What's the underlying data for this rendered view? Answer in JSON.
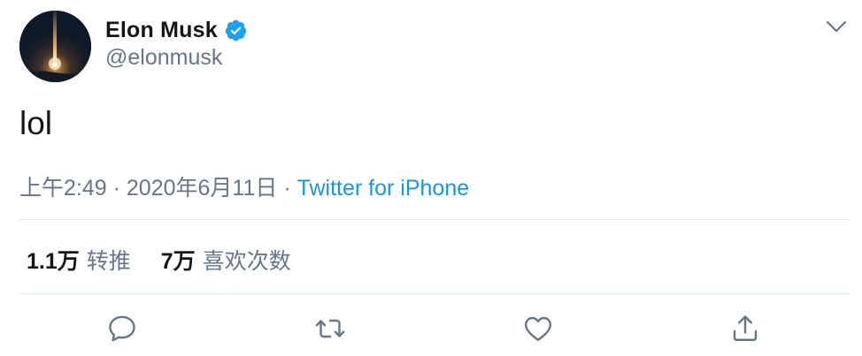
{
  "tweet": {
    "author": {
      "display_name": "Elon Musk",
      "handle": "@elonmusk",
      "verified": true,
      "avatar_icon": "rocket-launch-avatar"
    },
    "text": "lol",
    "time": "上午2:49",
    "date": "2020年6月11日",
    "separator": " · ",
    "source": "Twitter for iPhone"
  },
  "stats": {
    "retweets": {
      "count": "1.1万",
      "label": "转推"
    },
    "likes": {
      "count": "7万",
      "label": "喜欢次数"
    }
  },
  "actions": [
    {
      "name": "reply",
      "icon": "speech-bubble-icon"
    },
    {
      "name": "retweet",
      "icon": "retweet-arrows-icon"
    },
    {
      "name": "like",
      "icon": "heart-icon"
    },
    {
      "name": "share",
      "icon": "share-upload-icon"
    }
  ],
  "colors": {
    "text_primary": "#14171a",
    "text_secondary": "#657786",
    "link": "#1b95e0",
    "verified_badge": "#1da1f2",
    "divider": "#e1e8ed"
  }
}
